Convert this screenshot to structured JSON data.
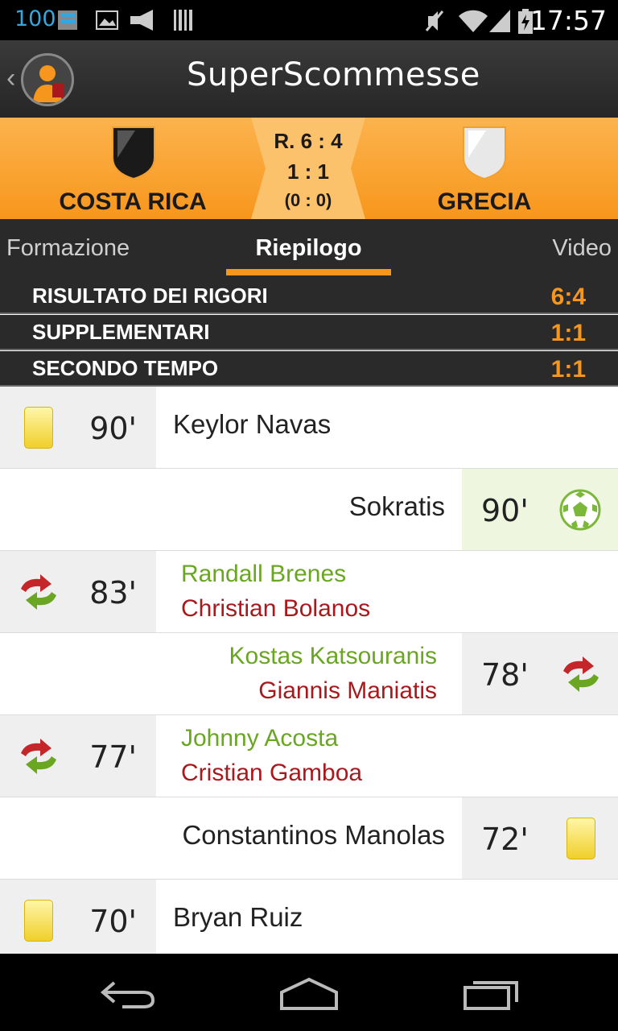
{
  "status_bar": {
    "battery_text": "100",
    "time": "17:57",
    "icons": [
      "storage-icon",
      "image-icon",
      "megaphone-icon",
      "barcode-icon",
      "mute-icon",
      "wifi-icon",
      "signal-icon",
      "battery-icon"
    ]
  },
  "app_bar": {
    "logo": "SuperScommesse"
  },
  "match": {
    "home_team": "COSTA RICA",
    "away_team": "GRECIA",
    "penalty_result": "R. 6 : 4",
    "score": "1 : 1",
    "halftime": "(0 : 0)",
    "colors": {
      "accent": "#f7961c",
      "dark": "#2a2a2a"
    }
  },
  "tabs": [
    {
      "label": "Formazione"
    },
    {
      "label": "Riepilogo",
      "active": true
    },
    {
      "label": "Video"
    }
  ],
  "summary": [
    {
      "label": "RISULTATO DEI RIGORI",
      "value": "6:4"
    },
    {
      "label": "SUPPLEMENTARI",
      "value": "1:1"
    },
    {
      "label": "SECONDO TEMPO",
      "value": "1:1"
    }
  ],
  "events": [
    {
      "side": "home",
      "type": "yellow-card",
      "minute": "90'",
      "name": "Keylor Navas"
    },
    {
      "side": "away",
      "type": "goal",
      "minute": "90'",
      "name": "Sokratis"
    },
    {
      "side": "home",
      "type": "substitution",
      "minute": "83'",
      "player_in": "Randall Brenes",
      "player_out": "Christian Bolanos"
    },
    {
      "side": "away",
      "type": "substitution",
      "minute": "78'",
      "player_in": "Kostas Katsouranis",
      "player_out": "Giannis Maniatis"
    },
    {
      "side": "home",
      "type": "substitution",
      "minute": "77'",
      "player_in": "Johnny Acosta",
      "player_out": "Cristian Gamboa"
    },
    {
      "side": "away",
      "type": "yellow-card",
      "minute": "72'",
      "name": "Constantinos Manolas"
    },
    {
      "side": "home",
      "type": "yellow-card",
      "minute": "70'",
      "name": "Bryan Ruiz"
    }
  ],
  "nav_bar": {
    "icons": [
      "back-icon",
      "home-icon",
      "recents-icon"
    ]
  }
}
